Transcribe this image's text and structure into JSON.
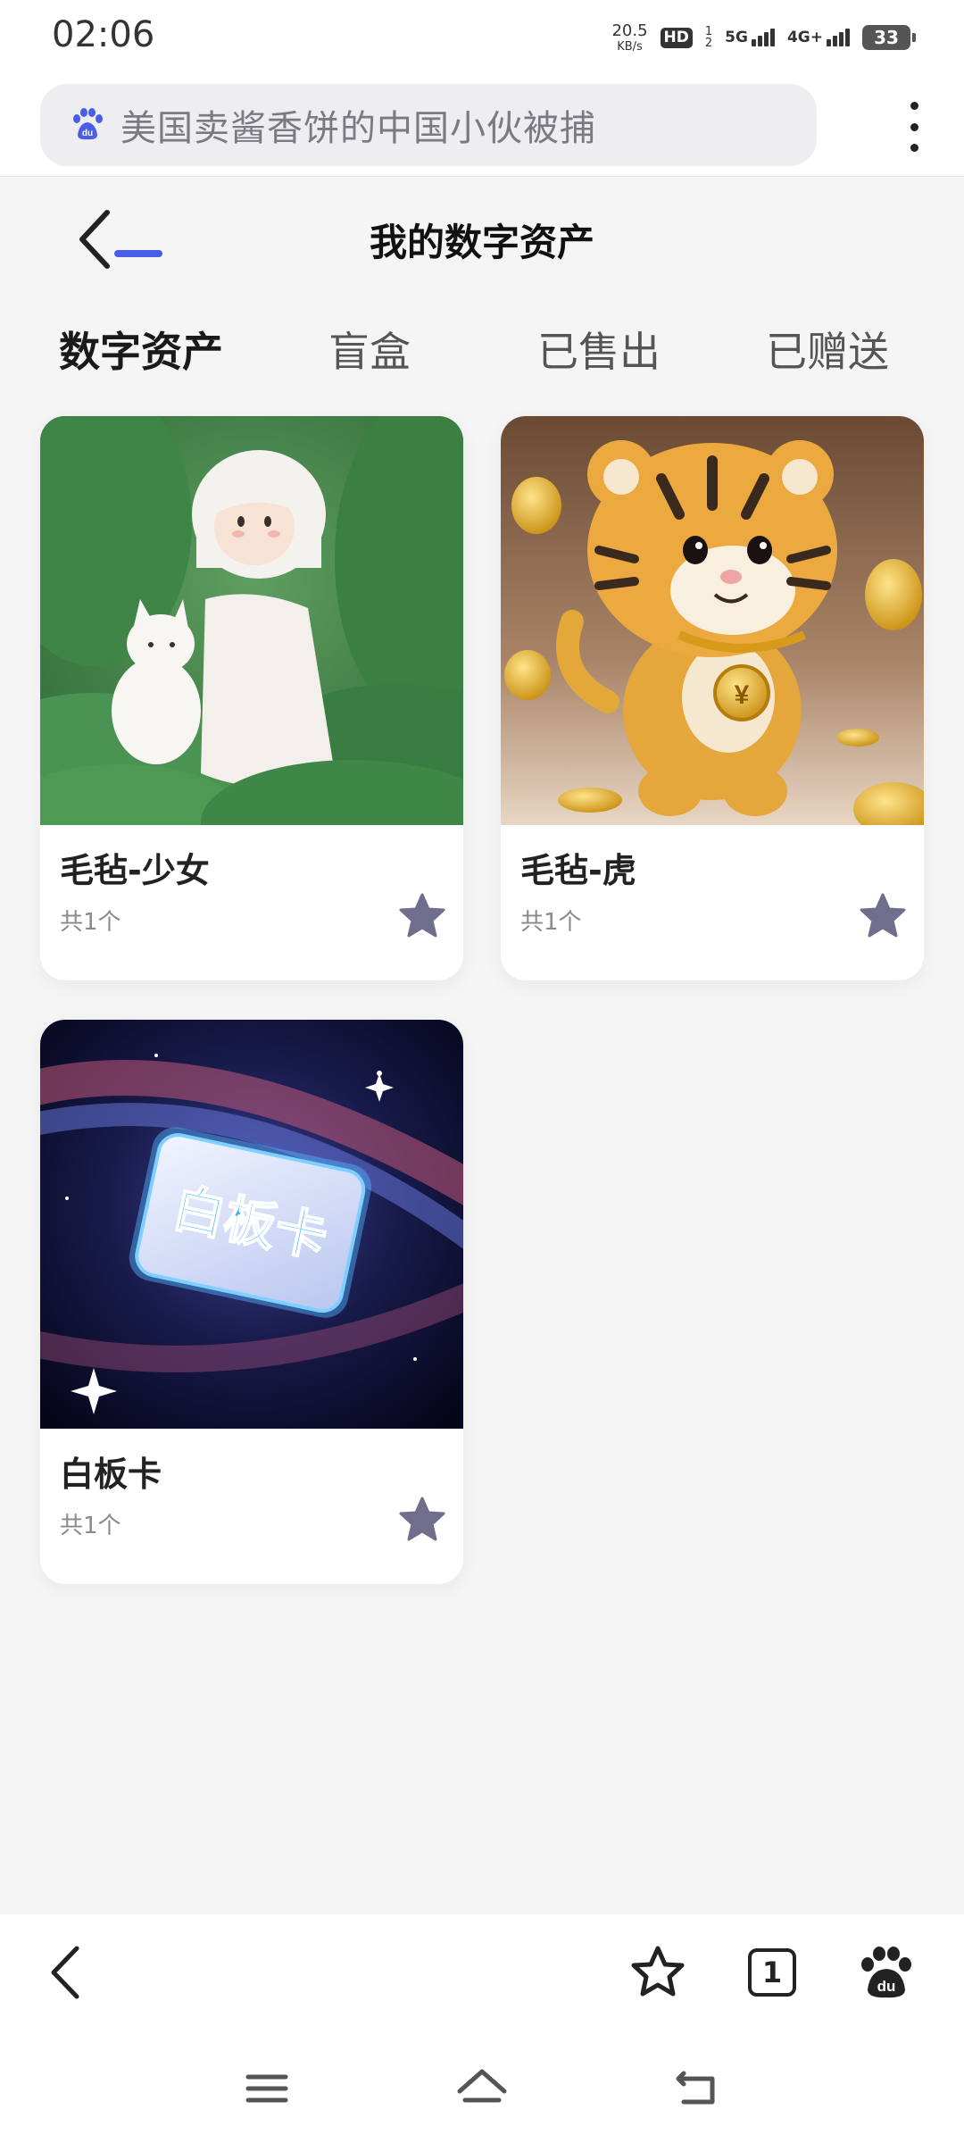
{
  "status": {
    "time": "02:06",
    "net_speed_value": "20.5",
    "net_speed_unit": "KB/s",
    "hd_label": "HD",
    "hd_sim_top": "1",
    "hd_sim_bottom": "2",
    "signal1_label": "5G",
    "signal2_label": "4G+",
    "battery": "33"
  },
  "search": {
    "query": "美国卖酱香饼的中国小伙被捕"
  },
  "header": {
    "title": "我的数字资产"
  },
  "tabs": [
    {
      "label": "数字资产",
      "active": true
    },
    {
      "label": "盲盒",
      "active": false
    },
    {
      "label": "已售出",
      "active": false
    },
    {
      "label": "已赠送",
      "active": false
    }
  ],
  "assets": [
    {
      "name": "毛毡-少女",
      "count": "共1个",
      "image": "felt-girl-with-cat"
    },
    {
      "name": "毛毡-虎",
      "count": "共1个",
      "image": "felt-tiger-with-coins"
    },
    {
      "name": "白板卡",
      "count": "共1个",
      "image": "galaxy-card",
      "card_text": "白板卡"
    }
  ],
  "toolbar": {
    "tab_count": "1"
  },
  "colors": {
    "accent": "#4a5de8",
    "star": "#6f6e8c",
    "background": "#f5f5f6"
  }
}
